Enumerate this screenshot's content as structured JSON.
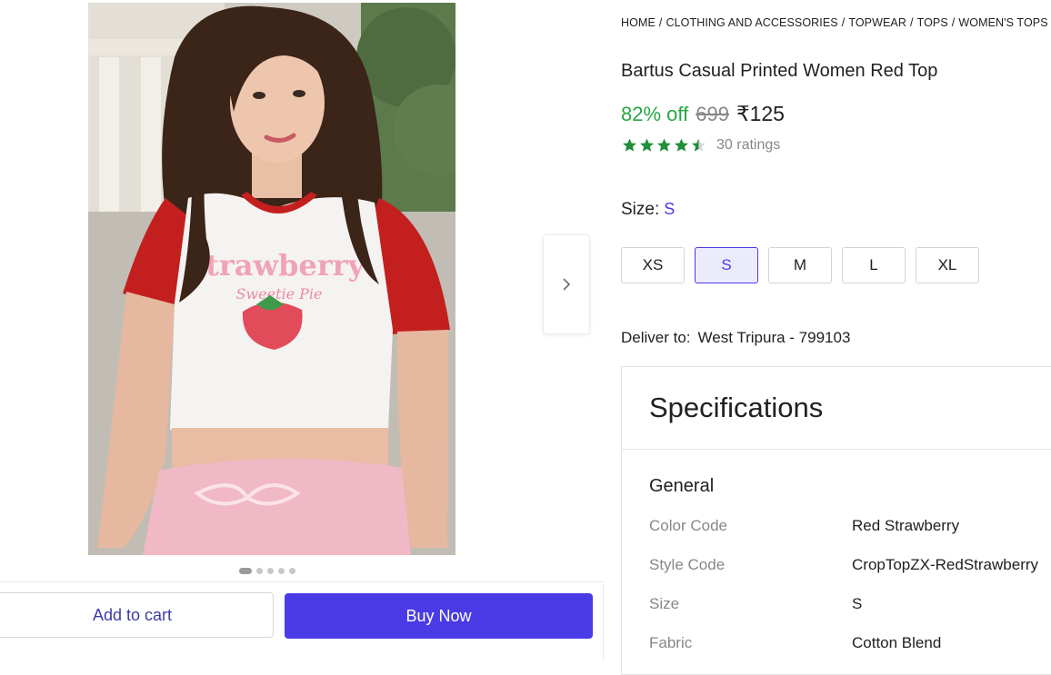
{
  "breadcrumb": [
    "HOME",
    "CLOTHING AND ACCESSORIES",
    "TOPWEAR",
    "TOPS",
    "WOMEN'S TOPS"
  ],
  "product": {
    "title": "Bartus Casual Printed Women Red Top",
    "discount": "82% off",
    "mrp": "699",
    "price": "₹125",
    "rating": 4.5,
    "ratings_count": "30 ratings",
    "shirt_print_line1": "Strawberry",
    "shirt_print_line2": "Sweetie Pie"
  },
  "size": {
    "label": "Size:",
    "selected": "S",
    "options": [
      "XS",
      "S",
      "M",
      "L",
      "XL"
    ]
  },
  "delivery": {
    "label": "Deliver to:",
    "location": "West Tripura - 799103"
  },
  "gallery": {
    "dot_count": 5,
    "active_index": 0
  },
  "actions": {
    "add_to_cart": "Add to cart",
    "buy_now": "Buy Now"
  },
  "specifications": {
    "title": "Specifications",
    "group": "General",
    "rows": [
      {
        "key": "Color Code",
        "value": "Red Strawberry"
      },
      {
        "key": "Style Code",
        "value": "CropTopZX-RedStrawberry"
      },
      {
        "key": "Size",
        "value": "S"
      },
      {
        "key": "Fabric",
        "value": "Cotton Blend"
      }
    ]
  },
  "colors": {
    "accent": "#4b3be6",
    "discount_green": "#26a541",
    "star_green": "#1e8f3a",
    "top_red": "#c41f1f",
    "shorts_pink": "#f1b8c6"
  },
  "icons": {
    "next": "chevron-right-icon",
    "star": "star-icon"
  }
}
